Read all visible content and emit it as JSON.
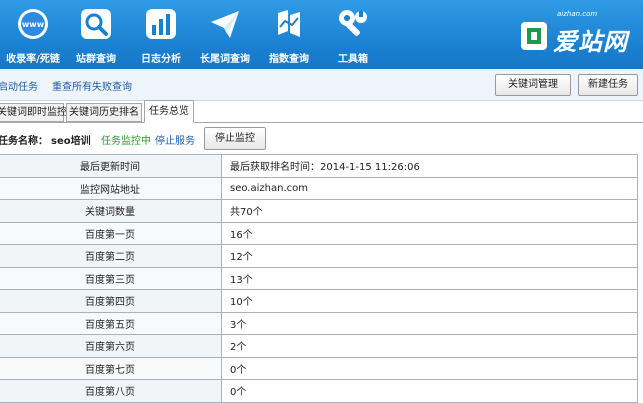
{
  "nav": [
    {
      "label": "收录率/死链",
      "icon": "www-globe-icon"
    },
    {
      "label": "站群查询",
      "icon": "search-icon"
    },
    {
      "label": "日志分析",
      "icon": "bar-chart-icon"
    },
    {
      "label": "长尾词查询",
      "icon": "paper-plane-icon"
    },
    {
      "label": "指数查询",
      "icon": "index-chart-icon"
    },
    {
      "label": "工具箱",
      "icon": "wrench-icon"
    }
  ],
  "logo": {
    "small": "aizhan.com",
    "text": "爱站网"
  },
  "toolbar": {
    "links": [
      "启动任务",
      "重查所有失败查询"
    ],
    "buttons": [
      "关键词管理",
      "新建任务"
    ]
  },
  "tabs": [
    "关键词即时监控",
    "关键词历史排名",
    "任务总览"
  ],
  "active_tab": 2,
  "task": {
    "name_label": "任务名称：",
    "name": "seo培训",
    "status": "任务监控中",
    "stop_service": "停止服务",
    "stop_monitor": "停止监控"
  },
  "table": [
    {
      "k": "最后更新时间",
      "v": "最后获取排名时间：2014-1-15 11:26:06"
    },
    {
      "k": "监控网站地址",
      "v": "seo.aizhan.com"
    },
    {
      "k": "关键词数量",
      "v": "共70个"
    },
    {
      "k": "百度第一页",
      "v": "16个"
    },
    {
      "k": "百度第二页",
      "v": "12个"
    },
    {
      "k": "百度第三页",
      "v": "13个"
    },
    {
      "k": "百度第四页",
      "v": "10个"
    },
    {
      "k": "百度第五页",
      "v": "3个"
    },
    {
      "k": "百度第六页",
      "v": "2个"
    },
    {
      "k": "百度第七页",
      "v": "0个"
    },
    {
      "k": "百度第八页",
      "v": "0个"
    }
  ]
}
